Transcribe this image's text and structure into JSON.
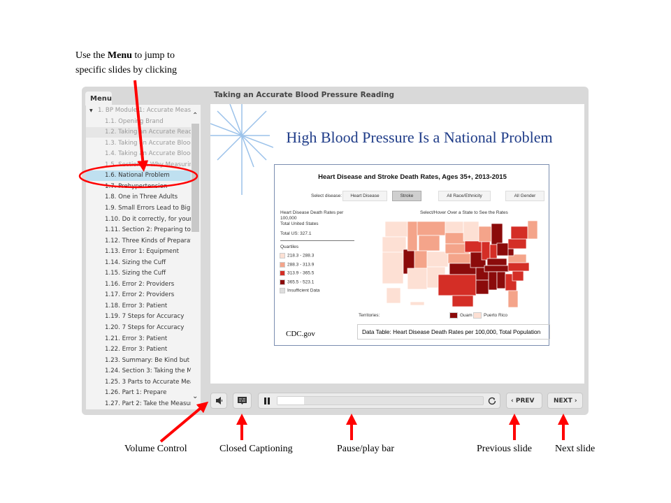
{
  "annotations": {
    "menu_hint_line1_pre": "Use the ",
    "menu_hint_bold": "Menu",
    "menu_hint_line1_post": " to jump to",
    "menu_hint_line2": "specific slides by clicking",
    "volume": "Volume  Control",
    "cc": "Closed Captioning",
    "playbar": "Pause/play bar",
    "prev": "Previous  slide",
    "next": "Next slide",
    "arrow_color": "#ff0000"
  },
  "menu": {
    "tab": "Menu",
    "items": [
      {
        "label": "1. BP Module 1: Accurate Measu...",
        "state": "dim"
      },
      {
        "label": "1.1. Opening Brand",
        "state": "dim"
      },
      {
        "label": "1.2. Taking an Accurate Reading",
        "state": "visited"
      },
      {
        "label": "1.3. Taking an Accurate Blood...",
        "state": "dim"
      },
      {
        "label": "1.4. Taking an Accurate Blood...",
        "state": "dim"
      },
      {
        "label": "1.5. Section 1: Why Measuring",
        "state": "dim"
      },
      {
        "label": "1.6. National Problem",
        "state": "selected"
      },
      {
        "label": "1.7. Prehypertension",
        "state": ""
      },
      {
        "label": "1.8. One in Three Adults",
        "state": ""
      },
      {
        "label": "1.9. Small Errors Lead to Big",
        "state": ""
      },
      {
        "label": "1.10. Do it correctly, for your p...",
        "state": ""
      },
      {
        "label": "1.11. Section 2: Preparing to M...",
        "state": ""
      },
      {
        "label": "1.12. Three Kinds of Preparati...",
        "state": ""
      },
      {
        "label": "1.13. Error 1: Equipment",
        "state": ""
      },
      {
        "label": "1.14. Sizing the Cuff",
        "state": ""
      },
      {
        "label": "1.15. Sizing the Cuff",
        "state": ""
      },
      {
        "label": "1.16. Error 2: Providers",
        "state": ""
      },
      {
        "label": "1.17. Error 2: Providers",
        "state": ""
      },
      {
        "label": "1.18. Error 3: Patient",
        "state": ""
      },
      {
        "label": "1.19. 7 Steps for Accuracy",
        "state": ""
      },
      {
        "label": "1.20. 7 Steps for Accuracy",
        "state": ""
      },
      {
        "label": "1.21. Error 3: Patient",
        "state": ""
      },
      {
        "label": "1.22. Error 3: Patient",
        "state": ""
      },
      {
        "label": "1.23. Summary: Be Kind but C...",
        "state": ""
      },
      {
        "label": "1.24. Section 3: Taking the Me...",
        "state": ""
      },
      {
        "label": "1.25. 3 Parts to Accurate Meas...",
        "state": ""
      },
      {
        "label": "1.26. Part 1: Prepare",
        "state": ""
      },
      {
        "label": "1.27. Part 2: Take the Measure...",
        "state": ""
      }
    ]
  },
  "slide": {
    "title": "Taking an Accurate Blood Pressure Reading",
    "heading": "High Blood Pressure Is a National Problem",
    "chart": {
      "title": "Heart Disease and Stroke Death Rates, Ages 35+, 2013-2015",
      "select_label": "Select disease:",
      "buttons": [
        "Heart Disease",
        "Stroke",
        "All Race/Ethnicity",
        "All Gender"
      ],
      "active_button": "Stroke",
      "legend_title": "Heart Disease Death Rates per 100,000",
      "legend_sub": "Total United States",
      "total": "Total US: 327.1",
      "quartiles_label": "Quartiles",
      "quartiles": [
        {
          "label": "218.3 - 288.3",
          "color": "#fde0d4"
        },
        {
          "label": "288.3 - 313.9",
          "color": "#f4a48a"
        },
        {
          "label": "313.9 - 365.5",
          "color": "#d42e26"
        },
        {
          "label": "365.5 - 523.1",
          "color": "#8b0b0b"
        },
        {
          "label": "Insufficient Data",
          "color": "#dddddd"
        }
      ],
      "map_hint": "Select/Hover Over a State to See the Rates",
      "territories_label": "Territories:",
      "territories": [
        {
          "label": "Guam",
          "quartile": 4
        },
        {
          "label": "Puerto Rico",
          "quartile": 1
        }
      ],
      "source": "CDC.gov",
      "data_table": "Data Table: Heart Disease Death Rates per 100,000, Total Population"
    }
  },
  "controls": {
    "progress": 0.13,
    "prev": "PREV",
    "next": "NEXT"
  }
}
